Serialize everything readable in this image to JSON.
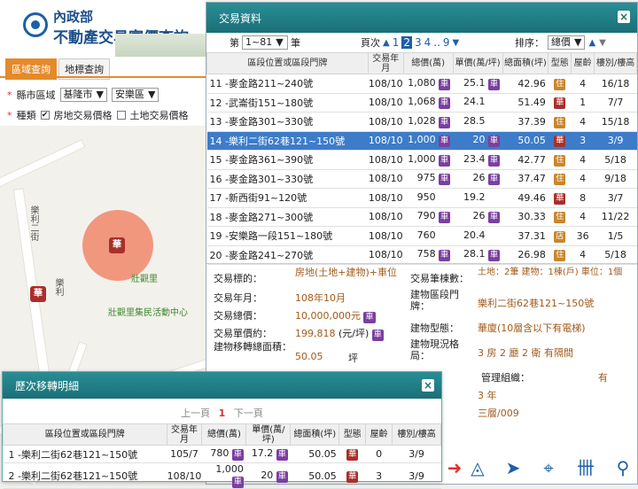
{
  "app": {
    "logo_line1": "內政部",
    "logo_line2": "不動產交易實價查詢"
  },
  "left_panel": {
    "tabs": [
      "區域查詢",
      "地標查詢"
    ],
    "city_label": "縣市區域",
    "city_value": "基隆市",
    "district_value": "安樂區",
    "type_label": "種類",
    "type_opt1": "房地交易價格",
    "type_opt2": "土地交易價格"
  },
  "map": {
    "labels": {
      "road1": "樂利二街",
      "road2": "樂利",
      "park": "壯觀里",
      "center": "壯觀里集民活動中心"
    },
    "pin_text": "華"
  },
  "main": {
    "title": "交易資料",
    "pager": {
      "prefix": "第",
      "range": "1~81",
      "suffix": "筆",
      "page_label": "頁次",
      "pages": [
        "1",
        "2",
        "3",
        "4",
        "..",
        "9"
      ],
      "sort_label": "排序：",
      "sort_value": "總價"
    },
    "columns": [
      "區段位置或區段門牌",
      "交易年月",
      "總價(萬)",
      "單價(萬/坪)",
      "總面積(坪)",
      "型態",
      "屋齡",
      "樓別/樓高"
    ],
    "rows": [
      {
        "no": "11",
        "addr": "-麥金路211~240號",
        "ym": "108/10",
        "total": "1,080",
        "car": true,
        "unit": "25.1",
        "ucar": true,
        "area": "42.96",
        "type": "住",
        "age": "4",
        "floor": "16/18"
      },
      {
        "no": "12",
        "addr": "-武崙街151~180號",
        "ym": "108/10",
        "total": "1,068",
        "car": true,
        "unit": "24.1",
        "ucar": false,
        "area": "51.49",
        "type": "華",
        "age": "1",
        "floor": "7/7"
      },
      {
        "no": "13",
        "addr": "-麥金路301~330號",
        "ym": "108/10",
        "total": "1,028",
        "car": true,
        "unit": "28.5",
        "ucar": false,
        "area": "37.39",
        "type": "住",
        "age": "4",
        "floor": "15/18"
      },
      {
        "no": "14",
        "addr": "-樂利二街62巷121~150號",
        "ym": "108/10",
        "total": "1,000",
        "car": true,
        "unit": "20",
        "ucar": true,
        "area": "50.05",
        "type": "華",
        "age": "3",
        "floor": "3/9",
        "hl": true
      },
      {
        "no": "15",
        "addr": "-麥金路361~390號",
        "ym": "108/10",
        "total": "1,000",
        "car": true,
        "unit": "23.4",
        "ucar": true,
        "area": "42.77",
        "type": "住",
        "age": "4",
        "floor": "5/18"
      },
      {
        "no": "16",
        "addr": "-麥金路301~330號",
        "ym": "108/10",
        "total": "975",
        "car": true,
        "unit": "26",
        "ucar": true,
        "area": "37.47",
        "type": "住",
        "age": "4",
        "floor": "9/18"
      },
      {
        "no": "17",
        "addr": "-新西街91~120號",
        "ym": "108/10",
        "total": "950",
        "car": false,
        "unit": "19.2",
        "ucar": false,
        "area": "49.46",
        "type": "華",
        "age": "8",
        "floor": "3/7"
      },
      {
        "no": "18",
        "addr": "-麥金路271~300號",
        "ym": "108/10",
        "total": "790",
        "car": true,
        "unit": "26",
        "ucar": true,
        "area": "30.33",
        "type": "住",
        "age": "4",
        "floor": "11/22"
      },
      {
        "no": "19",
        "addr": "-安樂路一段151~180號",
        "ym": "108/10",
        "total": "760",
        "car": false,
        "unit": "20.4",
        "ucar": false,
        "area": "37.31",
        "type": "店",
        "age": "36",
        "floor": "1/5"
      },
      {
        "no": "20",
        "addr": "-麥金路241~270號",
        "ym": "108/10",
        "total": "758",
        "car": true,
        "unit": "28.1",
        "ucar": true,
        "area": "26.98",
        "type": "住",
        "age": "4",
        "floor": "5/18"
      }
    ],
    "detail": {
      "target_label": "交易標的：",
      "target_value": "房地(土地+建物)+車位",
      "ym_label": "交易年月：",
      "ym_value": "108年10月",
      "total_label": "交易總價：",
      "total_value": "10,000,000元",
      "unit_label": "交易單價約：",
      "unit_value": "199,818",
      "unit_suffix": "(元/坪)",
      "transfer_label": "建物移轉總面積：",
      "transfer_value": "50.05",
      "transfer_unit": "坪",
      "count_label": "交易筆棟數：",
      "count_value": "土地：2筆 建物：1棟(戶) 車位：1個",
      "addr_label": "建物區段門牌：",
      "addr_value": "樂利二街62巷121~150號",
      "btype_label": "建物型態：",
      "btype_value": "華廈(10層含以下有電梯)",
      "layout_label": "建物現況格局：",
      "layout_value": "3 房 2 廳 2 衛 有隔間",
      "mgmt_label": "管理組織：",
      "mgmt_value": "有",
      "age_value": "3 年",
      "floor_value": "三層/009"
    }
  },
  "history": {
    "title": "歷次移轉明細",
    "prev": "上一頁",
    "cur": "1",
    "next": "下一頁",
    "columns": [
      "區段位置或區段門牌",
      "交易年月",
      "總價(萬)",
      "單價(萬/坪)",
      "總面積(坪)",
      "型態",
      "屋齡",
      "樓別/樓高"
    ],
    "rows": [
      {
        "no": "1",
        "addr": "-樂利二街62巷121~150號",
        "ym": "105/7",
        "total": "780",
        "unit": "17.2",
        "area": "50.05",
        "type": "華",
        "age": "0",
        "floor": "3/9"
      },
      {
        "no": "2",
        "addr": "-樂利二街62巷121~150號",
        "ym": "108/10",
        "total": "1,000",
        "unit": "20",
        "area": "50.05",
        "type": "華",
        "age": "3",
        "floor": "3/9"
      }
    ]
  }
}
